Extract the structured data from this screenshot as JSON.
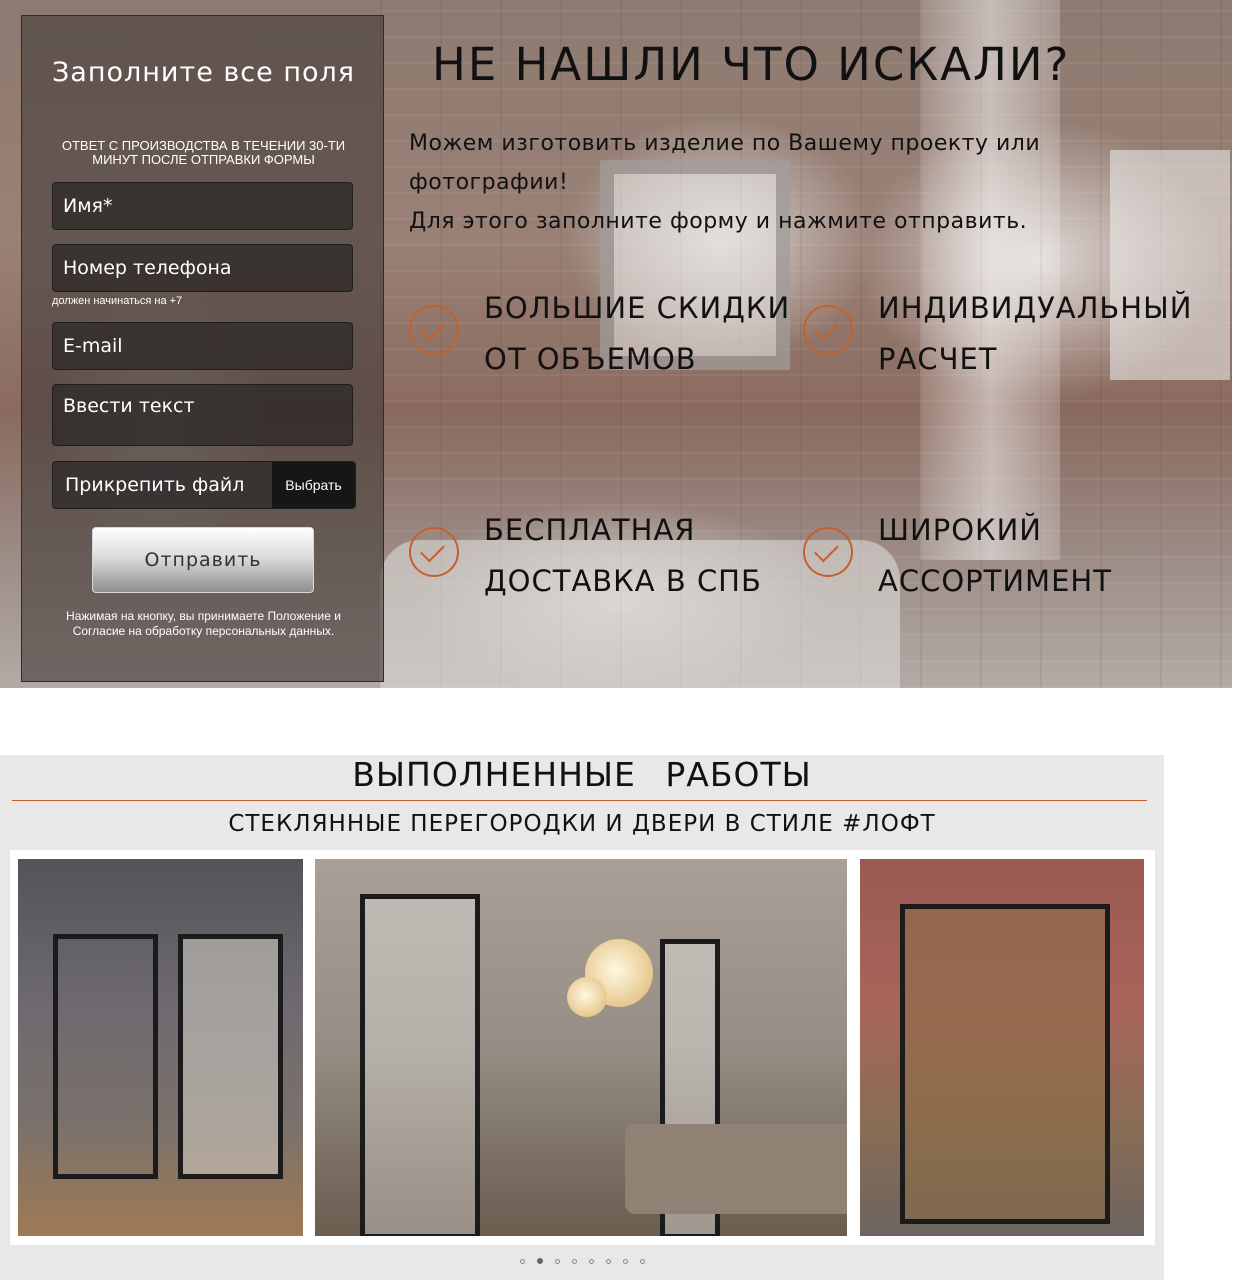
{
  "form": {
    "title": "Заполните все поля",
    "subtitle": "ОТВЕТ С ПРОИЗВОДСТВА В ТЕЧЕНИИ 30-ТИ МИНУТ ПОСЛЕ ОТПРАВКИ ФОРМЫ",
    "name_placeholder": "Имя*",
    "phone_placeholder": "Номер телефона",
    "phone_hint": "должен начинаться на +7",
    "email_placeholder": "E-mail",
    "text_placeholder": "Ввести текст",
    "file_label": "Прикрепить файл",
    "file_button": "Выбрать",
    "submit_label": "Отправить",
    "consent": "Нажимая на кнопку, вы принимаете Положение и Согласие на обработку персональных данных."
  },
  "hero": {
    "title": "НЕ НАШЛИ ЧТО ИСКАЛИ?",
    "desc_line1": "Можем изготовить изделие по Вашему проекту или фотографии!",
    "desc_line2": "Для этого заполните форму и нажмите отправить.",
    "features": [
      {
        "text": "БОЛЬШИЕ СКИДКИ ОТ ОБЪЕМОВ",
        "icon": "check-circle-icon"
      },
      {
        "text": "ИНДИВИДУАЛЬНЫЙ РАСЧЕТ",
        "icon": "check-circle-icon"
      },
      {
        "text": "БЕСПЛАТНАЯ ДОСТАВКА В СПБ",
        "icon": "check-circle-icon"
      },
      {
        "text": "ШИРОКИЙ АССОРТИМЕНТ",
        "icon": "check-circle-icon"
      }
    ],
    "accent_color": "#c4602e"
  },
  "works": {
    "title": "ВЫПОЛНЕННЫЕ РАБОТЫ",
    "subtitle": "СТЕКЛЯННЫЕ ПЕРЕГОРОДКИ И ДВЕРИ В СТИЛЕ #ЛОФТ",
    "slider": {
      "total": 8,
      "active": 2
    }
  }
}
